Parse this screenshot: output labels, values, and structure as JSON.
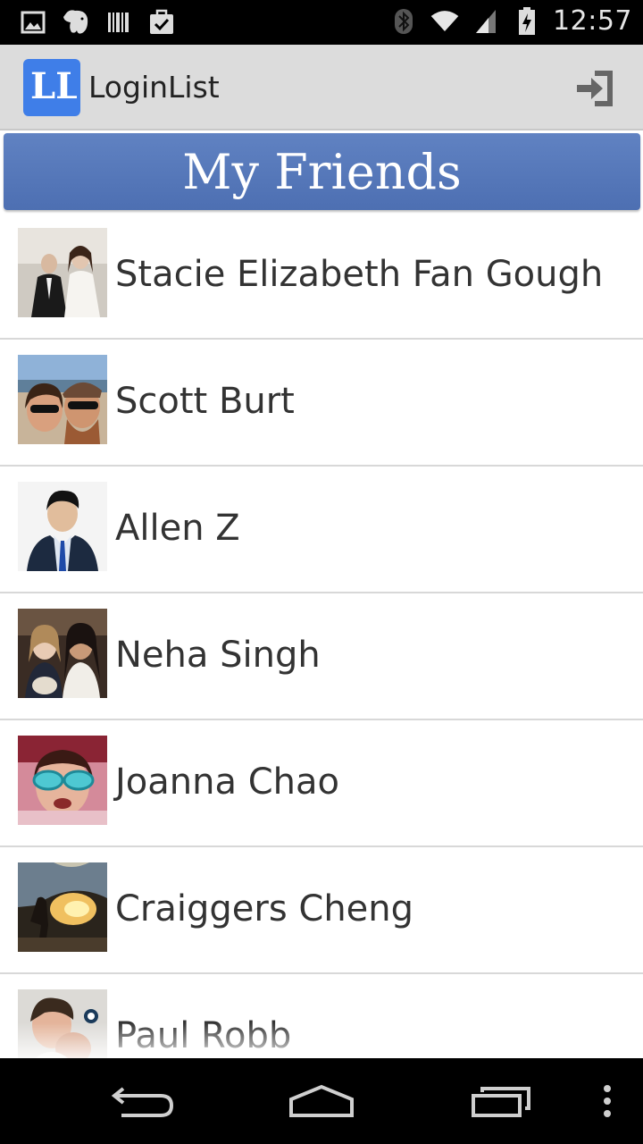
{
  "status_bar": {
    "time": "12:57",
    "left_icons": [
      "gallery-icon",
      "evernote-icon",
      "barcode-icon",
      "task-icon"
    ],
    "right_icons": [
      "bluetooth-icon",
      "wifi-icon",
      "signal-icon",
      "battery-charging-icon"
    ]
  },
  "action_bar": {
    "logo_text": "LL",
    "title": "LoginList",
    "action_icon": "login-icon"
  },
  "header": {
    "title": "My Friends"
  },
  "friends": [
    {
      "name": "Stacie Elizabeth Fan Gough"
    },
    {
      "name": "Scott Burt"
    },
    {
      "name": "Allen Z"
    },
    {
      "name": "Neha Singh"
    },
    {
      "name": "Joanna Chao"
    },
    {
      "name": "Craiggers Cheng"
    },
    {
      "name": "Paul Robb"
    }
  ],
  "nav_bar": {
    "buttons": [
      "back-icon",
      "home-icon",
      "recent-apps-icon",
      "overflow-menu-icon"
    ]
  },
  "colors": {
    "header_bg": "#5576b8",
    "action_bar_bg": "#dcdcdc",
    "logo_bg": "#3f7ee8"
  }
}
